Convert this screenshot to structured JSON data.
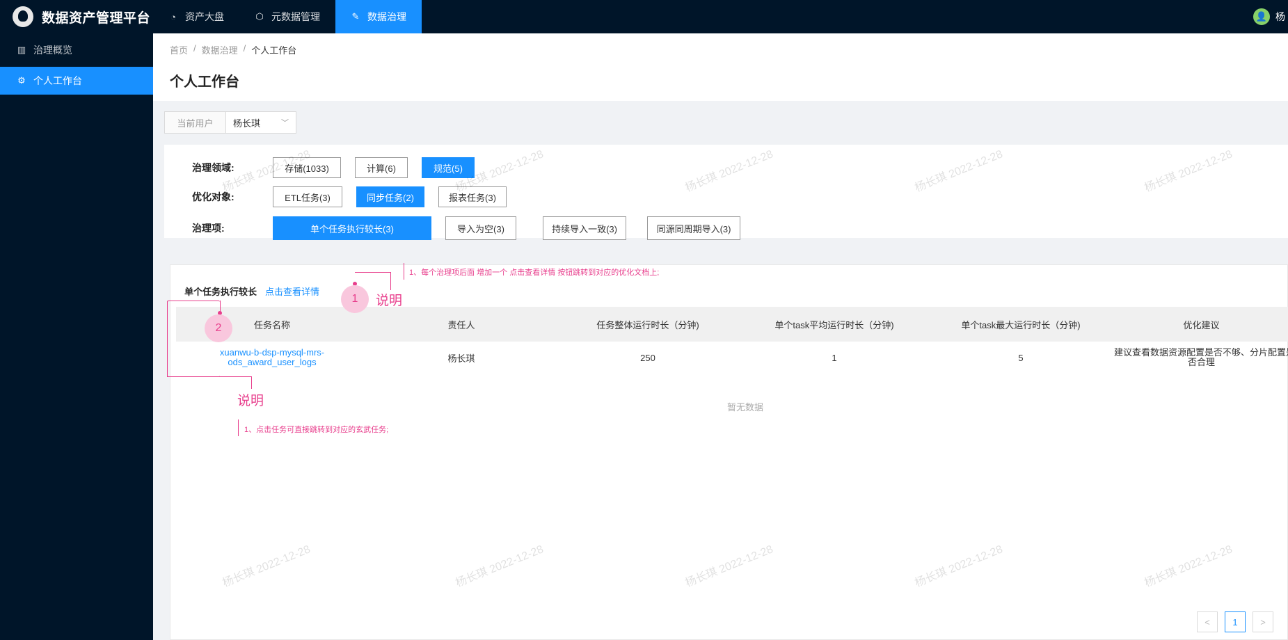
{
  "app": {
    "title": "数据资产管理平台"
  },
  "top_nav": [
    {
      "label": "资产大盘",
      "icon": "dashboard-icon"
    },
    {
      "label": "元数据管理",
      "icon": "cube-icon"
    },
    {
      "label": "数据治理",
      "icon": "wrench-icon"
    }
  ],
  "user": {
    "name": "杨"
  },
  "sidebar": {
    "items": [
      {
        "label": "治理概览",
        "icon": "bar-chart-icon"
      },
      {
        "label": "个人工作台",
        "icon": "bug-icon"
      }
    ]
  },
  "breadcrumb": [
    "首页",
    "/",
    "数据治理",
    "/",
    "个人工作台"
  ],
  "page": {
    "title": "个人工作台"
  },
  "filter": {
    "label": "当前用户",
    "value": "杨长琪"
  },
  "domain": {
    "label": "治理领域:",
    "tags": [
      "存储(1033)",
      "计算(6)",
      "规范(5)"
    ]
  },
  "target": {
    "label": "优化对象:",
    "tags": [
      "ETL任务(3)",
      "同步任务(2)",
      "报表任务(3)"
    ]
  },
  "item": {
    "label": "治理项:",
    "tags": [
      "单个任务执行较长(3)",
      "导入为空(3)",
      "持续导入一致(3)",
      "同源同周期导入(3)"
    ]
  },
  "section": {
    "title": "单个任务执行较长",
    "detail_link": "点击查看详情"
  },
  "table": {
    "headers": [
      "任务名称",
      "责任人",
      "任务整体运行时长（分钟)",
      "单个task平均运行时长（分钟)",
      "单个task最大运行时长（分钟)",
      "优化建议"
    ],
    "rows": [
      {
        "task_name_1": "xuanwu-b-dsp-mysql-mrs-",
        "task_name_2": "ods_award_user_logs",
        "owner": "杨长琪",
        "total": "250",
        "avg": "1",
        "max": "5",
        "advice_1": "建议查看数据资源配置是否不够、分片配置是",
        "advice_2": "否合理"
      }
    ],
    "empty_text": "暂无数据"
  },
  "pagination": {
    "prev": "<",
    "current": "1",
    "next": ">"
  },
  "annotations": {
    "a1": {
      "num": "1",
      "title": "说明",
      "note": "1、每个治理项后面 增加一个 点击查看详情 按钮跳转到对应的优化文档上;"
    },
    "a2": {
      "num": "2",
      "title": "说明",
      "note": "1、点击任务可直接跳转到对应的玄武任务;"
    }
  },
  "watermark": "杨长琪 2022-12-28",
  "colors": {
    "primary": "#1890ff",
    "nav_bg": "#001529",
    "annotation": "#e83e8c"
  }
}
